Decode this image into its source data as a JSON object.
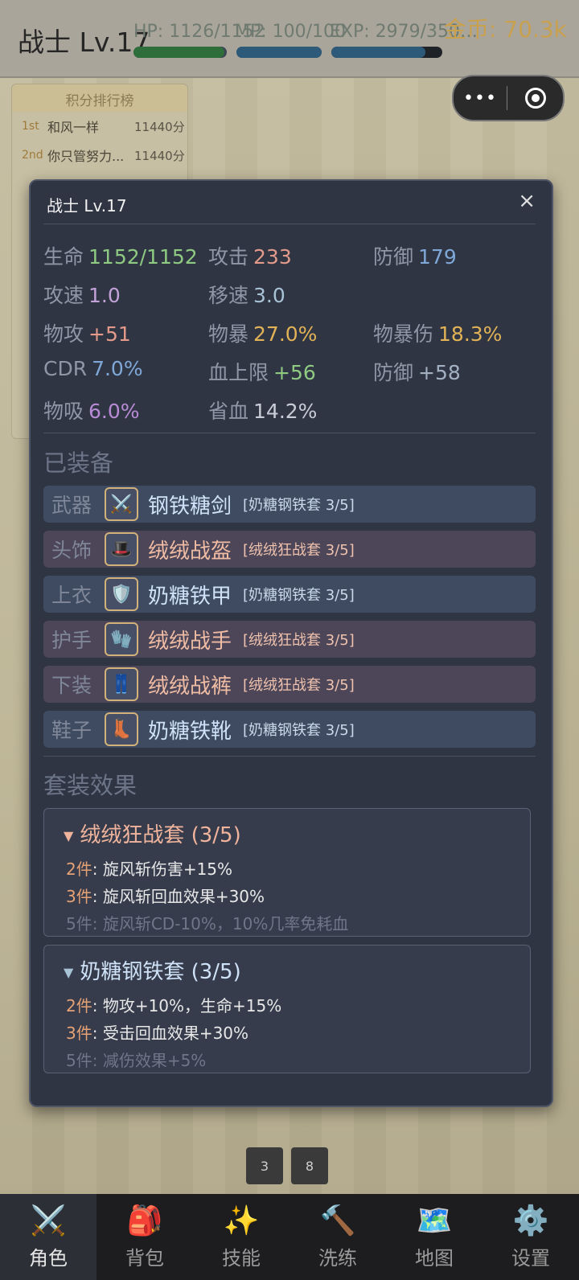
{
  "hud": {
    "title": "战士 Lv.17",
    "hp_label": "HP: 1126/1152",
    "hp_frac": 0.977,
    "mp_label": "MP: 100/100",
    "mp_frac": 1.0,
    "exp_label": "EXP: 2979/350…",
    "exp_frac": 0.85,
    "gold": "金币: 70.3k",
    "colors": {
      "hp": "#2e6e3a",
      "mp": "#2e5a7a",
      "exp": "#2e5a7a"
    }
  },
  "mini_menu": {
    "dots": "•••",
    "icon": "target-icon"
  },
  "ranking": {
    "title": "积分排行榜",
    "rows": [
      {
        "pos": "1st",
        "name": "和风一样",
        "score": "11440分"
      },
      {
        "pos": "2nd",
        "name": "你只管努力...",
        "score": "11440分"
      }
    ]
  },
  "bg_counters": [
    "3",
    "8"
  ],
  "modal": {
    "title": "战士  Lv.17",
    "close": "×",
    "stats": [
      {
        "label": "生命",
        "value": "1152/1152",
        "color": "#8fca83"
      },
      {
        "label": "攻击",
        "value": "233",
        "color": "#e39a8a"
      },
      {
        "label": "防御",
        "value": "179",
        "color": "#7fa8d8"
      },
      {
        "label": "攻速",
        "value": "1.0",
        "color": "#c2a2d8"
      },
      {
        "label": "移速",
        "value": "3.0",
        "color": "#a8c2d6"
      },
      {
        "label": "物攻",
        "value": "+51",
        "color": "#e39a8a"
      },
      {
        "label": "物暴",
        "value": "27.0%",
        "color": "#e2b257"
      },
      {
        "label": "物暴伤",
        "value": "18.3%",
        "color": "#e2b257"
      },
      {
        "label": "CDR",
        "value": "7.0%",
        "color": "#7fa8d8"
      },
      {
        "label": "血上限",
        "value": "+56",
        "color": "#8fca83"
      },
      {
        "label": "防御",
        "value": "+58",
        "color": "#a3b0c2"
      },
      {
        "label": "物吸",
        "value": "6.0%",
        "color": "#b98bd6"
      },
      {
        "label": "省血",
        "value": "14.2%",
        "color": "#c8ccd6"
      }
    ],
    "equipped_title": "已装备",
    "equipment": [
      {
        "slot": "武器",
        "icon": "crossed-swords-icon",
        "glyph": "⚔️",
        "name": "钢铁糖剑",
        "set": "[奶糖钢铁套 3/5]",
        "kind": "gang"
      },
      {
        "slot": "头饰",
        "icon": "top-hat-icon",
        "glyph": "🎩",
        "name": "绒绒战盔",
        "set": "[绒绒狂战套 3/5]",
        "kind": "rong"
      },
      {
        "slot": "上衣",
        "icon": "shield-icon",
        "glyph": "🛡️",
        "name": "奶糖铁甲",
        "set": "[奶糖钢铁套 3/5]",
        "kind": "gang"
      },
      {
        "slot": "护手",
        "icon": "gloves-icon",
        "glyph": "🧤",
        "name": "绒绒战手",
        "set": "[绒绒狂战套 3/5]",
        "kind": "rong"
      },
      {
        "slot": "下装",
        "icon": "jeans-icon",
        "glyph": "👖",
        "name": "绒绒战裤",
        "set": "[绒绒狂战套 3/5]",
        "kind": "rong"
      },
      {
        "slot": "鞋子",
        "icon": "boot-icon",
        "glyph": "👢",
        "name": "奶糖铁靴",
        "set": "[奶糖钢铁套 3/5]",
        "kind": "gang"
      }
    ],
    "set_effects_title": "套装效果",
    "sets": [
      {
        "name": "绒绒狂战套 (3/5)",
        "color": "#f0b49c",
        "lines": [
          {
            "k": "2件",
            "t": ": 旋风斩伤害+15%",
            "active": true
          },
          {
            "k": "3件",
            "t": ": 旋风斩回血效果+30%",
            "active": true
          },
          {
            "k": "5件",
            "t": ": 旋风斩CD-10%，10%几率免耗血",
            "active": false
          }
        ]
      },
      {
        "name": "奶糖钢铁套 (3/5)",
        "color": "#cfe2f7",
        "lines": [
          {
            "k": "2件",
            "t": ": 物攻+10%，生命+15%",
            "active": true
          },
          {
            "k": "3件",
            "t": ": 受击回血效果+30%",
            "active": true
          },
          {
            "k": "5件",
            "t": ": 减伤效果+5%",
            "active": false
          }
        ]
      }
    ]
  },
  "nav": [
    {
      "label": "角色",
      "icon": "crossed-swords-icon",
      "glyph": "⚔️",
      "active": true
    },
    {
      "label": "背包",
      "icon": "backpack-icon",
      "glyph": "🎒",
      "active": false
    },
    {
      "label": "技能",
      "icon": "sparkles-icon",
      "glyph": "✨",
      "active": false
    },
    {
      "label": "洗练",
      "icon": "hammer-icon",
      "glyph": "🔨",
      "active": false
    },
    {
      "label": "地图",
      "icon": "map-icon",
      "glyph": "🗺️",
      "active": false
    },
    {
      "label": "设置",
      "icon": "gear-icon",
      "glyph": "⚙️",
      "active": false
    }
  ]
}
